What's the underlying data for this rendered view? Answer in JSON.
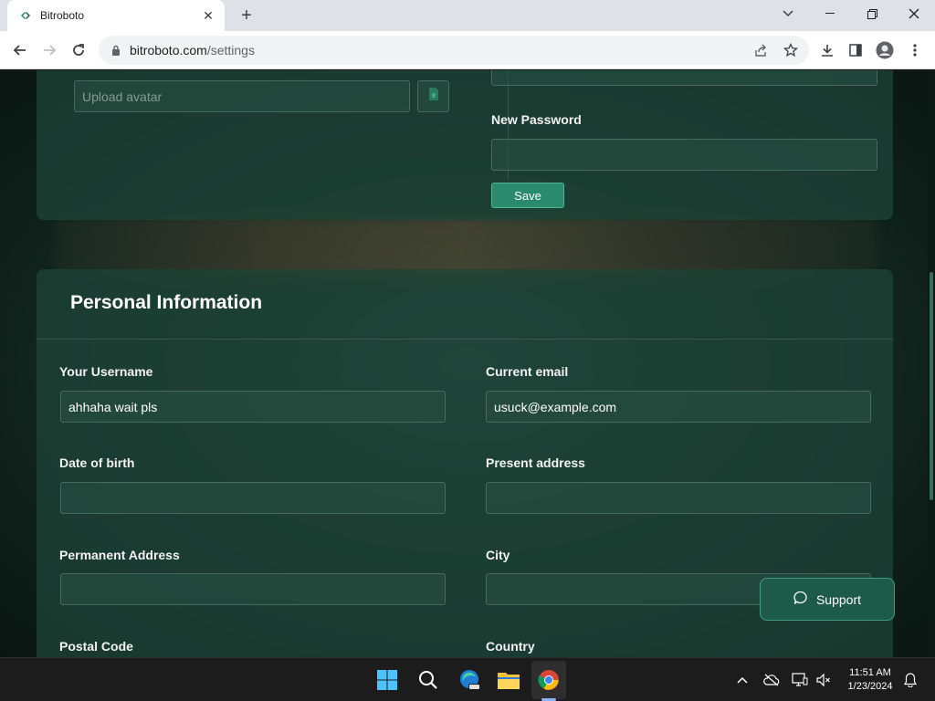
{
  "browser": {
    "tab_title": "Bitroboto",
    "url_domain": "bitroboto.com",
    "url_path": "/settings"
  },
  "top_card": {
    "upload_avatar_placeholder": "Upload avatar",
    "new_password_label": "New Password",
    "save_label": "Save"
  },
  "personal_info": {
    "title": "Personal Information",
    "username_label": "Your Username",
    "username_value": "ahhaha wait pls",
    "email_label": "Current email",
    "email_value": "usuck@example.com",
    "dob_label": "Date of birth",
    "present_address_label": "Present address",
    "permanent_address_label": "Permanent Address",
    "city_label": "City",
    "postal_code_label": "Postal Code",
    "country_label": "Country"
  },
  "support": {
    "label": "Support"
  },
  "taskbar": {
    "time": "11:51 AM",
    "date": "1/23/2024"
  },
  "colors": {
    "accent": "#2a8a6e",
    "card": "#1e4237",
    "taskbar": "#1c1c1c"
  }
}
